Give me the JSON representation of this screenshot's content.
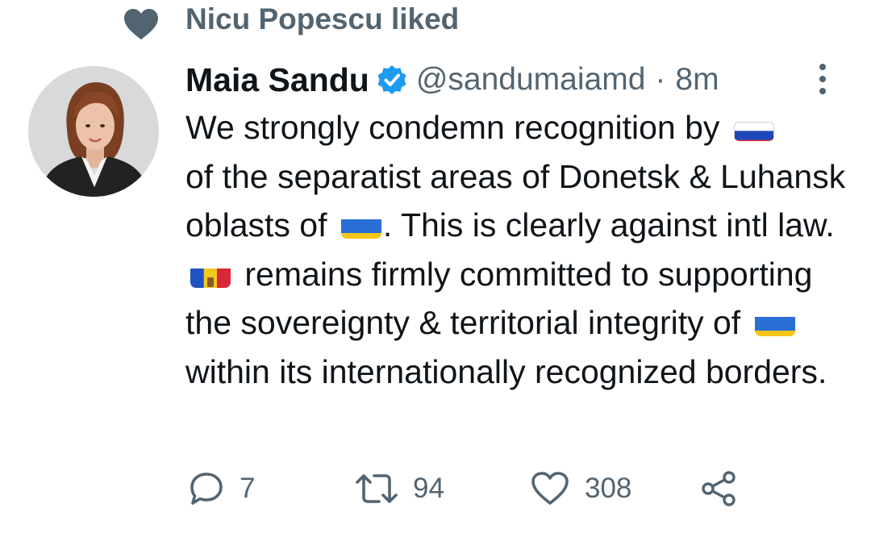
{
  "social_context": {
    "text": "Nicu Popescu liked",
    "icon": "heart-icon"
  },
  "tweet": {
    "author": {
      "display_name": "Maia Sandu",
      "handle": "@sandumaiamd",
      "verified": true,
      "avatar": "profile-photo"
    },
    "separator": "·",
    "timestamp": "8m",
    "text_parts": {
      "p1": "We strongly condemn recognition by",
      "p2": "of the separatist areas of Donetsk & Luhansk oblasts of",
      "p3": ". This is clearly against intl law.",
      "p4": "remains firmly committed to supporting the sovereignty & territorial integrity of",
      "p5": "within its internationally recognized borders."
    },
    "flags": [
      "russia-flag",
      "ukraine-flag",
      "moldova-flag",
      "ukraine-flag"
    ],
    "actions": {
      "reply_count": "7",
      "retweet_count": "94",
      "like_count": "308"
    }
  },
  "colors": {
    "text_primary": "#0f1419",
    "text_secondary": "#536471",
    "verified_blue": "#1d9bf0"
  }
}
